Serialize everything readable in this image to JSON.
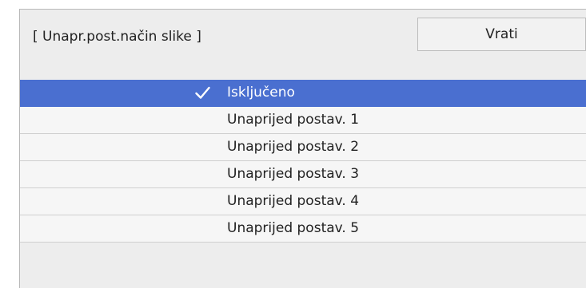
{
  "header": {
    "title": "[ Unapr.post.način slike ]",
    "back_label": "Vrati"
  },
  "options": [
    {
      "label": "Isključeno",
      "selected": true
    },
    {
      "label": "Unaprijed postav. 1",
      "selected": false
    },
    {
      "label": "Unaprijed postav. 2",
      "selected": false
    },
    {
      "label": "Unaprijed postav. 3",
      "selected": false
    },
    {
      "label": "Unaprijed postav. 4",
      "selected": false
    },
    {
      "label": "Unaprijed postav. 5",
      "selected": false
    }
  ],
  "colors": {
    "selection": "#4a6fd0",
    "panel": "#ededed",
    "row": "#f6f6f6"
  },
  "icons": {
    "selected_marker": "check-icon"
  }
}
